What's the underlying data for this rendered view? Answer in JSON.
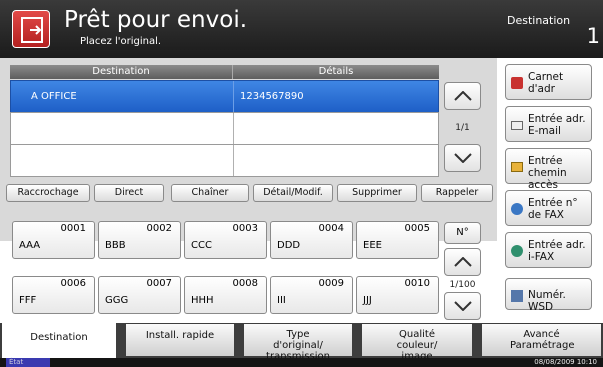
{
  "header": {
    "title": "Prêt pour envoi.",
    "subtitle": "Placez l'original.",
    "destination_label": "Destination",
    "destination_count": "1"
  },
  "table": {
    "col_destination": "Destination",
    "col_details": "Détails",
    "rows": [
      {
        "destination": "A OFFICE",
        "details": "1234567890",
        "selected": true
      },
      {
        "destination": "",
        "details": ""
      },
      {
        "destination": "",
        "details": ""
      }
    ],
    "page": "1/1"
  },
  "actions": {
    "hook": "Raccrochage",
    "direct": "Direct",
    "chain": "Chaîner",
    "detail": "Détail/Modif.",
    "delete": "Supprimer",
    "recall": "Rappeler"
  },
  "onetouch": {
    "tiles": [
      {
        "num": "0001",
        "name": "AAA"
      },
      {
        "num": "0002",
        "name": "BBB"
      },
      {
        "num": "0003",
        "name": "CCC"
      },
      {
        "num": "0004",
        "name": "DDD"
      },
      {
        "num": "0005",
        "name": "EEE"
      },
      {
        "num": "0006",
        "name": "FFF"
      },
      {
        "num": "0007",
        "name": "GGG"
      },
      {
        "num": "0008",
        "name": "HHH"
      },
      {
        "num": "0009",
        "name": "III"
      },
      {
        "num": "0010",
        "name": "JJJ"
      }
    ],
    "no_label": "N°",
    "page": "1/100"
  },
  "right_menu": {
    "address_book": "Carnet d'adr",
    "email_entry": "Entrée adr. E-mail",
    "folder_entry": "Entrée chemin accès",
    "fax_entry": "Entrée n° de FAX",
    "ifax_entry": "Entrée adr. i-FAX",
    "wsd_scan": "Numér. WSD"
  },
  "tabs": [
    "Destination",
    "Install. rapide",
    "Type d'original/ transmission",
    "Qualité couleur/ image",
    "Avancé Paramétrage"
  ],
  "status": {
    "label": "État",
    "datetime": "08/08/2009    10:10"
  },
  "colors": {
    "header": "#2b2b2b",
    "selected_row": "#2f74d8",
    "accent_red": "#d8302e"
  }
}
